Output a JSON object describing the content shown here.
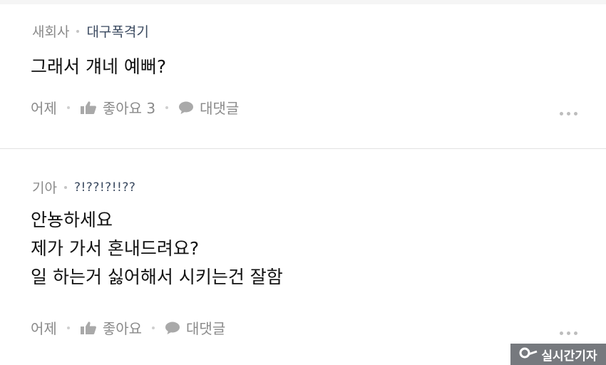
{
  "comments": [
    {
      "level": "새회사",
      "nickname": "대구폭격기",
      "body": [
        "그래서 걔네 예뻐?"
      ],
      "time": "어제",
      "like_label": "좋아요 3",
      "reply_label": "대댓글"
    },
    {
      "level": "기아",
      "nickname": "?!??!?!!??",
      "body": [
        "안뇽하세요",
        "제가 가서 혼내드려요?",
        "일 하는거 싫어해서 시키는건 잘함"
      ],
      "time": "어제",
      "like_label": "좋아요",
      "reply_label": "대댓글"
    }
  ],
  "watermark": {
    "text": "실시간기자"
  },
  "colors": {
    "text": "#111111",
    "meta": "#8a8a8a",
    "nick": "#3b4a60",
    "divider": "#e2e2e2"
  },
  "icons": {
    "like": "thumbs-up-icon",
    "reply": "speech-bubble-icon",
    "more": "more-dots-icon"
  }
}
